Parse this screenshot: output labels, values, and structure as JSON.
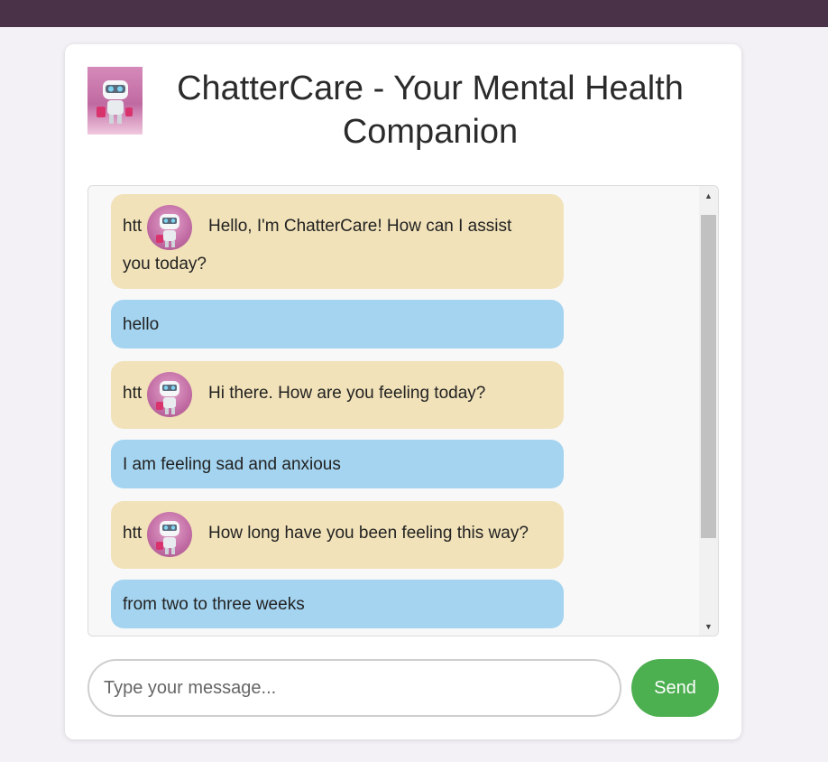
{
  "header": {
    "title": "ChatterCare - Your Mental Health Companion",
    "title_line1": "ChatterCare - Your Mental Health",
    "title_line2": "Companion"
  },
  "chat": {
    "bot_avatar_prefix": "htt",
    "messages": [
      {
        "sender": "bot",
        "line1": "Hello, I'm ChatterCare! How can I assist",
        "line2": "you today?"
      },
      {
        "sender": "user",
        "text": "hello"
      },
      {
        "sender": "bot",
        "line1": "Hi there. How are you feeling today?"
      },
      {
        "sender": "user",
        "text": "I am feeling sad and anxious"
      },
      {
        "sender": "bot",
        "line1": "How long have you been feeling this way?"
      },
      {
        "sender": "user",
        "text": "from two to three weeks"
      }
    ]
  },
  "composer": {
    "placeholder": "Type your message...",
    "send_label": "Send"
  },
  "colors": {
    "topbar": "#4a3349",
    "bot_bubble": "#f1e2b9",
    "user_bubble": "#a4d4f0",
    "send_button": "#4caf50"
  },
  "icons": {
    "logo": "robot-mascot-icon",
    "bot_avatar": "robot-avatar-icon",
    "scroll_up": "triangle-up-icon",
    "scroll_down": "triangle-down-icon"
  }
}
